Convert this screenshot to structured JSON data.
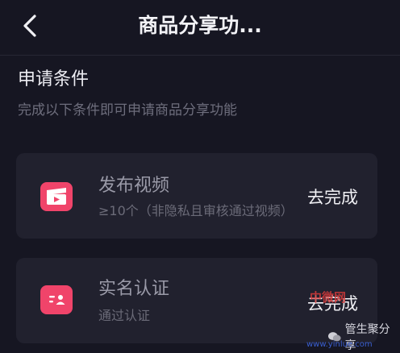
{
  "header": {
    "back_icon": "chevron-left-icon",
    "title": "商品分享功..."
  },
  "section": {
    "title": "申请条件",
    "subtitle": "完成以下条件即可申请商品分享功能"
  },
  "requirements": [
    {
      "icon": "video-clapper-icon",
      "title": "发布视频",
      "subtitle": "≥10个（非隐私且审核通过视频）",
      "action": "去完成"
    },
    {
      "icon": "id-card-icon",
      "title": "实名认证",
      "subtitle": "通过认证",
      "action": "去完成"
    }
  ],
  "watermark": {
    "site_name": "中微网",
    "badge_text": "管生聚分享",
    "url": "www.yinlue.com"
  },
  "colors": {
    "background": "#161622",
    "card": "#21212e",
    "accent": "#f0446a"
  }
}
